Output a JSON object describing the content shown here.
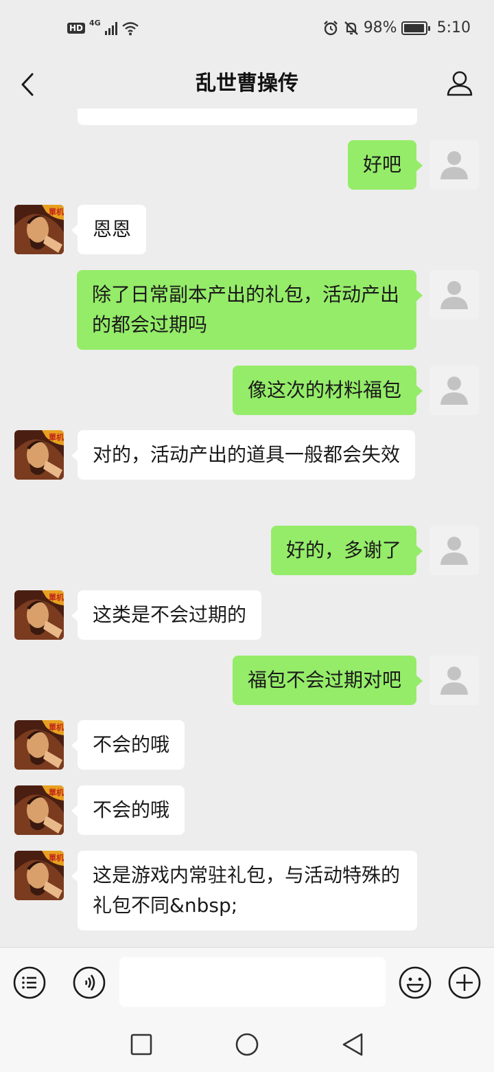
{
  "status_bar": {
    "hd": "HD",
    "network": "4G",
    "battery_percent": "98%",
    "battery_level": 0.98,
    "time": "5:10"
  },
  "nav": {
    "title": "乱世曹操传",
    "back_icon": "chevron-left-icon",
    "profile_icon": "person-outline-icon"
  },
  "messages": [
    {
      "side": "out",
      "text": "好吧"
    },
    {
      "side": "in",
      "text": "恩恩"
    },
    {
      "side": "out",
      "text": "除了日常副本产出的礼包，活动产出的都会过期吗"
    },
    {
      "side": "out",
      "text": "像这次的材料福包"
    },
    {
      "side": "in",
      "text": "对的，活动产出的道具一般都会失效"
    },
    {
      "side": "out",
      "text": "好的，多谢了"
    },
    {
      "side": "in",
      "text": "这类是不会过期的"
    },
    {
      "side": "out",
      "text": "福包不会过期对吧"
    },
    {
      "side": "in",
      "text": "不会的哦"
    },
    {
      "side": "in",
      "text": "不会的哦"
    },
    {
      "side": "in",
      "text": "这是游戏内常驻礼包，与活动特殊的礼包不同&nbsp;"
    }
  ],
  "input_bar": {
    "menu_icon": "list-menu-icon",
    "voice_icon": "voice-icon",
    "emoji_icon": "emoji-icon",
    "plus_icon": "plus-icon",
    "value": ""
  },
  "colors": {
    "background": "#ededed",
    "outgoing_bubble": "#95ec69",
    "incoming_bubble": "#ffffff"
  }
}
